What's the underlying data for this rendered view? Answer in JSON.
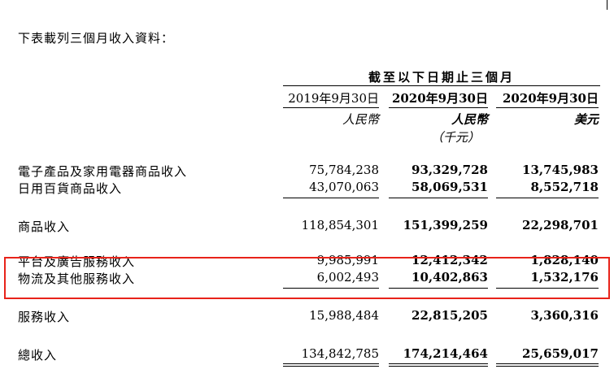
{
  "intro": "下表載列三個月收入資料：",
  "period_header": "截至以下日期止三個月",
  "columns": [
    {
      "date": "2019年9月30日",
      "currency": "人民幣",
      "unit": ""
    },
    {
      "date": "2020年9月30日",
      "currency": "人民幣",
      "unit": "（千元）"
    },
    {
      "date": "2020年9月30日",
      "currency": "美元",
      "unit": ""
    }
  ],
  "rows": [
    {
      "label": "電子產品及家用電器商品收入",
      "v2019": "75,784,238",
      "v2020": "93,329,728",
      "usd": "13,745,983"
    },
    {
      "label": "日用百貨商品收入",
      "v2019": "43,070,063",
      "v2020": "58,069,531",
      "usd": "8,552,718"
    },
    {
      "label": "商品收入",
      "v2019": "118,854,301",
      "v2020": "151,399,259",
      "usd": "22,298,701"
    },
    {
      "label": "平台及廣告服務收入",
      "v2019": "9,985,991",
      "v2020": "12,412,342",
      "usd": "1,828,140"
    },
    {
      "label": "物流及其他服務收入",
      "v2019": "6,002,493",
      "v2020": "10,402,863",
      "usd": "1,532,176"
    },
    {
      "label": "服務收入",
      "v2019": "15,988,484",
      "v2020": "22,815,205",
      "usd": "3,360,316"
    },
    {
      "label": "總收入",
      "v2019": "134,842,785",
      "v2020": "174,214,464",
      "usd": "25,659,017"
    }
  ],
  "highlight_color": "#e8231a"
}
